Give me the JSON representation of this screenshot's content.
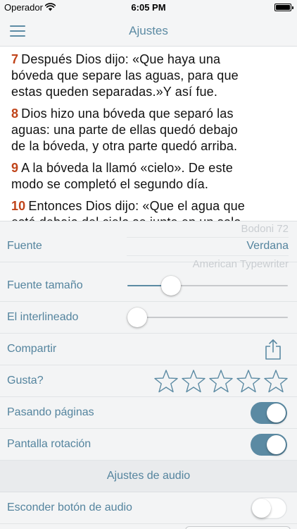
{
  "status_bar": {
    "carrier": "Operador",
    "time": "6:05 PM"
  },
  "nav": {
    "title": "Ajustes",
    "menu_icon": "hamburger-icon"
  },
  "verses": [
    {
      "number": "7",
      "lines": [
        "Después Dios dijo: «Que haya una",
        "bóveda que separe las aguas, para que",
        "estas queden separadas.»Y así fue."
      ]
    },
    {
      "number": "8",
      "lines": [
        "Dios hizo una bóveda que separó las",
        "aguas: una parte de ellas quedó debajo",
        "de la bóveda, y otra parte quedó arriba."
      ]
    },
    {
      "number": "9",
      "lines": [
        "A la bóveda la llamó «cielo». De este",
        "modo se completó el segundo día."
      ]
    },
    {
      "number": "10",
      "lines": [
        "Entonces Dios dijo: «Que el agua que",
        "está debajo del cielo se junte en un solo"
      ]
    }
  ],
  "settings": {
    "font": {
      "label": "Fuente",
      "options_above": "Bodoni 72",
      "selected": "Verdana",
      "options_below": "American Typewriter"
    },
    "font_size": {
      "label": "Fuente tamaño",
      "value_fraction": 0.24
    },
    "line_spacing": {
      "label": "El interlineado",
      "value_fraction": 0.0
    },
    "share": {
      "label": "Compartir",
      "icon": "share-icon"
    },
    "rating": {
      "label": "Gusta?",
      "stars_total": 5,
      "stars_filled": 0,
      "icon": "star-outline-icon"
    },
    "page_turning": {
      "label": "Pasando páginas",
      "on": true
    },
    "screen_rotation": {
      "label": "Pantalla rotación",
      "on": true
    },
    "audio_section": {
      "title": "Ajustes de audio"
    },
    "hide_audio_button": {
      "label": "Esconder botón de audio",
      "on": false
    }
  },
  "colors": {
    "accent": "#5b8aa3",
    "verse_number": "#c0441a",
    "settings_bg": "#f3f4f5"
  }
}
